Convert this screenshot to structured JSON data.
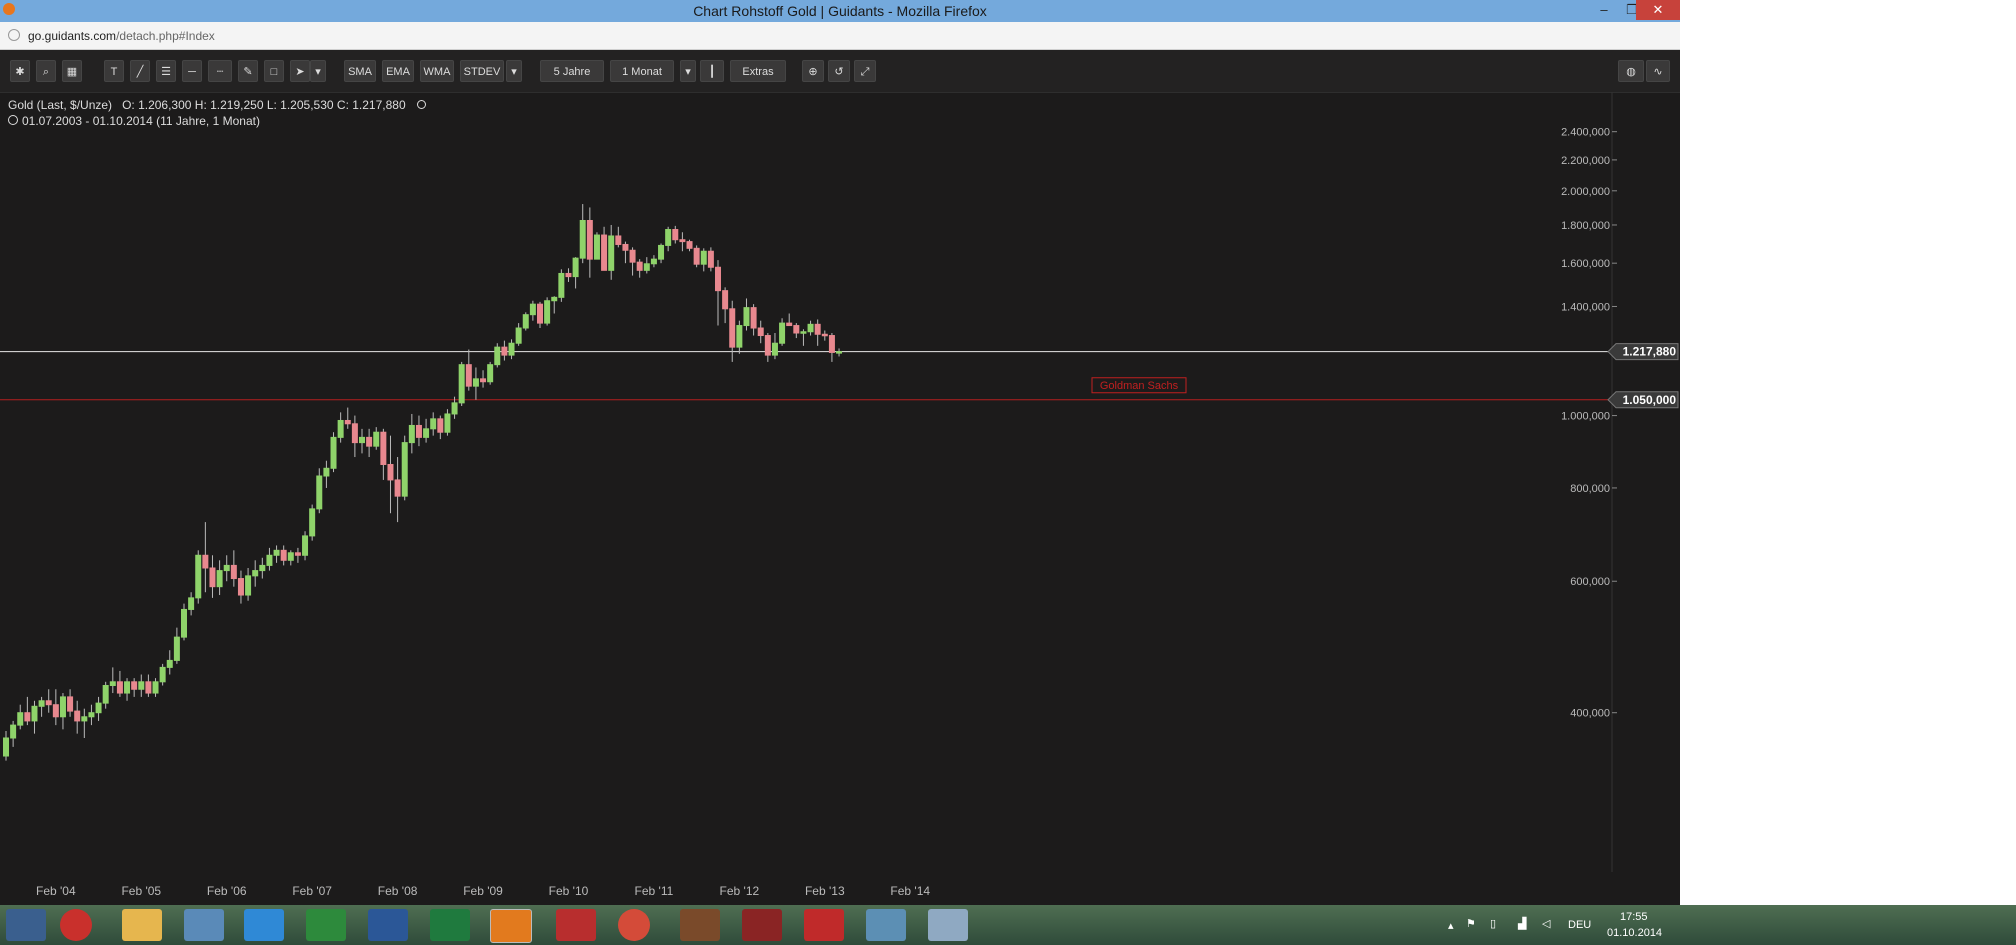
{
  "window": {
    "title": "Chart Rohstoff Gold | Guidants - Mozilla Firefox",
    "url_host": "go.guidants.com",
    "url_path": "/detach.php#Index",
    "min_label": "–",
    "max_label": "❐",
    "close_label": "✕"
  },
  "toolbar": {
    "sma": "SMA",
    "ema": "EMA",
    "wma": "WMA",
    "stdev": "STDEV",
    "range": "5 Jahre",
    "interval": "1 Monat",
    "extras": "Extras",
    "text_tool": "T",
    "dropdown_arrow": "▾"
  },
  "info": {
    "instrument": "Gold (Last, $/Unze)",
    "ohlc": "O: 1.206,300   H: 1.219,250   L: 1.205,530   C: 1.217,880",
    "period": "01.07.2003 - 01.10.2014 (11 Jahre, 1 Monat)"
  },
  "chart_data": {
    "type": "candlestick",
    "y_scale": "log",
    "ylim": [
      300,
      2450
    ],
    "y_ticks": [
      400,
      600,
      800,
      1000,
      1400,
      1600,
      1800,
      2000,
      2200,
      2400
    ],
    "y_tick_labels": [
      "400,000",
      "600,000",
      "800,000",
      "1.000,000",
      "1.400,000",
      "1.600,000",
      "1.800,000",
      "2.000,000",
      "2.200,000",
      "2.400,000"
    ],
    "x_labels": [
      "Feb '04",
      "Feb '05",
      "Feb '06",
      "Feb '07",
      "Feb '08",
      "Feb '09",
      "Feb '10",
      "Feb '11",
      "Feb '12",
      "Feb '13",
      "Feb '14"
    ],
    "last_price_label": "1.217,880",
    "last_price": 1217.88,
    "line_label": "1.050,000",
    "line_value": 1050,
    "line_note": "Goldman Sachs",
    "up_color": "#8fd36a",
    "down_color": "#e8888f",
    "ohlc": [
      [
        350,
        378,
        345,
        370
      ],
      [
        370,
        390,
        360,
        385
      ],
      [
        385,
        410,
        380,
        400
      ],
      [
        400,
        420,
        385,
        390
      ],
      [
        390,
        415,
        375,
        408
      ],
      [
        408,
        420,
        395,
        415
      ],
      [
        415,
        430,
        400,
        410
      ],
      [
        410,
        430,
        385,
        395
      ],
      [
        395,
        425,
        380,
        420
      ],
      [
        420,
        430,
        395,
        402
      ],
      [
        402,
        415,
        375,
        390
      ],
      [
        390,
        405,
        370,
        395
      ],
      [
        395,
        410,
        385,
        400
      ],
      [
        400,
        420,
        390,
        412
      ],
      [
        412,
        440,
        405,
        435
      ],
      [
        435,
        460,
        425,
        440
      ],
      [
        440,
        455,
        420,
        425
      ],
      [
        425,
        445,
        415,
        440
      ],
      [
        440,
        445,
        420,
        430
      ],
      [
        430,
        450,
        420,
        440
      ],
      [
        440,
        450,
        420,
        425
      ],
      [
        425,
        445,
        420,
        440
      ],
      [
        440,
        465,
        435,
        460
      ],
      [
        460,
        485,
        450,
        470
      ],
      [
        470,
        520,
        465,
        505
      ],
      [
        505,
        560,
        500,
        550
      ],
      [
        550,
        580,
        540,
        570
      ],
      [
        570,
        660,
        560,
        650
      ],
      [
        650,
        720,
        580,
        625
      ],
      [
        625,
        650,
        570,
        590
      ],
      [
        590,
        640,
        575,
        620
      ],
      [
        620,
        650,
        600,
        630
      ],
      [
        630,
        660,
        590,
        605
      ],
      [
        605,
        620,
        560,
        575
      ],
      [
        575,
        625,
        565,
        610
      ],
      [
        610,
        640,
        590,
        620
      ],
      [
        620,
        645,
        605,
        630
      ],
      [
        630,
        665,
        620,
        650
      ],
      [
        650,
        670,
        635,
        660
      ],
      [
        660,
        670,
        630,
        640
      ],
      [
        640,
        660,
        630,
        655
      ],
      [
        655,
        665,
        635,
        650
      ],
      [
        650,
        700,
        640,
        690
      ],
      [
        690,
        760,
        680,
        750
      ],
      [
        750,
        850,
        740,
        830
      ],
      [
        830,
        870,
        800,
        850
      ],
      [
        850,
        950,
        840,
        935
      ],
      [
        935,
        1010,
        920,
        985
      ],
      [
        985,
        1025,
        960,
        975
      ],
      [
        975,
        1000,
        880,
        920
      ],
      [
        920,
        960,
        890,
        935
      ],
      [
        935,
        960,
        880,
        910
      ],
      [
        910,
        965,
        900,
        950
      ],
      [
        950,
        960,
        820,
        860
      ],
      [
        860,
        940,
        740,
        820
      ],
      [
        820,
        880,
        720,
        780
      ],
      [
        780,
        940,
        770,
        920
      ],
      [
        920,
        1005,
        890,
        970
      ],
      [
        970,
        1000,
        910,
        935
      ],
      [
        935,
        990,
        920,
        960
      ],
      [
        960,
        1010,
        940,
        990
      ],
      [
        990,
        1000,
        930,
        950
      ],
      [
        950,
        1020,
        940,
        1005
      ],
      [
        1005,
        1060,
        990,
        1040
      ],
      [
        1040,
        1180,
        1030,
        1170
      ],
      [
        1170,
        1226,
        1080,
        1095
      ],
      [
        1095,
        1160,
        1050,
        1120
      ],
      [
        1120,
        1150,
        1090,
        1110
      ],
      [
        1110,
        1180,
        1100,
        1170
      ],
      [
        1170,
        1250,
        1160,
        1235
      ],
      [
        1235,
        1260,
        1185,
        1205
      ],
      [
        1205,
        1265,
        1190,
        1250
      ],
      [
        1250,
        1330,
        1240,
        1310
      ],
      [
        1310,
        1375,
        1300,
        1365
      ],
      [
        1365,
        1425,
        1340,
        1410
      ],
      [
        1410,
        1420,
        1310,
        1330
      ],
      [
        1330,
        1440,
        1320,
        1425
      ],
      [
        1425,
        1445,
        1370,
        1440
      ],
      [
        1440,
        1570,
        1420,
        1550
      ],
      [
        1550,
        1575,
        1510,
        1535
      ],
      [
        1535,
        1630,
        1480,
        1625
      ],
      [
        1625,
        1920,
        1600,
        1825
      ],
      [
        1825,
        1900,
        1530,
        1620
      ],
      [
        1620,
        1760,
        1660,
        1745
      ],
      [
        1745,
        1790,
        1580,
        1565
      ],
      [
        1565,
        1800,
        1520,
        1740
      ],
      [
        1740,
        1790,
        1680,
        1695
      ],
      [
        1695,
        1710,
        1600,
        1665
      ],
      [
        1665,
        1680,
        1540,
        1605
      ],
      [
        1605,
        1620,
        1530,
        1565
      ],
      [
        1565,
        1630,
        1550,
        1597
      ],
      [
        1597,
        1640,
        1580,
        1620
      ],
      [
        1620,
        1700,
        1600,
        1690
      ],
      [
        1690,
        1790,
        1660,
        1775
      ],
      [
        1775,
        1795,
        1700,
        1720
      ],
      [
        1720,
        1760,
        1660,
        1710
      ],
      [
        1710,
        1720,
        1660,
        1675
      ],
      [
        1675,
        1690,
        1580,
        1595
      ],
      [
        1595,
        1675,
        1560,
        1660
      ],
      [
        1660,
        1680,
        1560,
        1580
      ],
      [
        1580,
        1615,
        1320,
        1470
      ],
      [
        1470,
        1485,
        1330,
        1390
      ],
      [
        1390,
        1425,
        1180,
        1235
      ],
      [
        1235,
        1340,
        1210,
        1320
      ],
      [
        1320,
        1435,
        1300,
        1395
      ],
      [
        1395,
        1410,
        1280,
        1310
      ],
      [
        1310,
        1340,
        1250,
        1280
      ],
      [
        1280,
        1290,
        1180,
        1205
      ],
      [
        1205,
        1290,
        1190,
        1250
      ],
      [
        1250,
        1350,
        1240,
        1330
      ],
      [
        1330,
        1370,
        1320,
        1320
      ],
      [
        1320,
        1330,
        1270,
        1290
      ],
      [
        1290,
        1305,
        1240,
        1295
      ],
      [
        1295,
        1340,
        1280,
        1325
      ],
      [
        1325,
        1345,
        1240,
        1285
      ],
      [
        1285,
        1300,
        1260,
        1280
      ],
      [
        1280,
        1290,
        1180,
        1215
      ],
      [
        1215,
        1230,
        1200,
        1218
      ]
    ]
  },
  "taskbar": {
    "lang": "DEU",
    "time": "17:55",
    "date": "01.10.2014"
  }
}
